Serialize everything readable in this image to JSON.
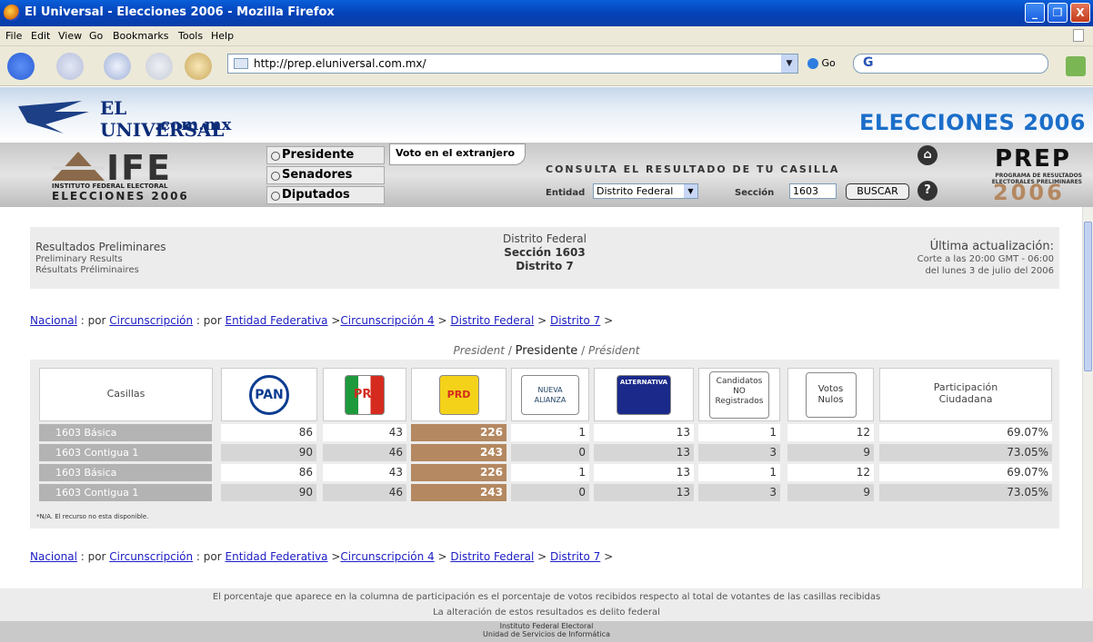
{
  "window": {
    "title": "El Universal - Elecciones 2006 - Mozilla Firefox",
    "min": "_",
    "max": "❐",
    "close": "X"
  },
  "menu": [
    "File",
    "Edit",
    "View",
    "Go",
    "Bookmarks",
    "Tools",
    "Help"
  ],
  "toolbar": {
    "url": "http://prep.eluniversal.com.mx/",
    "go_label": "Go",
    "search_value": "G"
  },
  "header": {
    "logo_line1": "EL UNIVERSAL",
    "logo_line2": ".com.mx",
    "elecciones": "ELECCIONES 2006"
  },
  "ife": {
    "big": "IFE",
    "small": "INSTITUTO FEDERAL ELECTORAL",
    "small2": "ELECCIONES 2006"
  },
  "nav": {
    "presidente": "Presidente",
    "senadores": "Senadores",
    "diputados": "Diputados",
    "voto": "Voto en el extranjero"
  },
  "search": {
    "consulta": "CONSULTA EL RESULTADO DE TU CASILLA",
    "entidad_label": "Entidad",
    "entidad_value": "Distrito Federal",
    "seccion_label": "Sección",
    "seccion_value": "1603",
    "buscar": "BUSCAR",
    "home_icon": "⌂",
    "help_icon": "?"
  },
  "prep": {
    "title": "PREP",
    "subtitle": "PROGRAMA DE RESULTADOS ELECTORALES PRELIMINARES",
    "year": "2006"
  },
  "results": {
    "es": "Resultados Preliminares",
    "en": "Preliminary Results",
    "fr": "Résultats Préliminaires",
    "entidad": "Distrito Federal",
    "seccion": "Sección 1603",
    "distrito": "Distrito 7",
    "ult": "Última actualización:",
    "corte": "Corte a las 20:00 GMT - 06:00",
    "fecha": "del lunes 3 de julio del 2006"
  },
  "breadcrumb": {
    "nacional": "Nacional",
    "sep1": " : por ",
    "circ": "Circunscripción",
    "sep2": " : por ",
    "entfed": "Entidad Federativa",
    "gt1": " >",
    "circ4": "Circunscripción 4",
    "gt2": " > ",
    "df": "Distrito Federal",
    "gt3": " > ",
    "d7": "Distrito 7",
    "gt4": " >"
  },
  "president": {
    "en": "President",
    "sep": " / ",
    "es": "Presidente",
    "sep2": " / ",
    "fr": "Président"
  },
  "table": {
    "casillas": "Casillas",
    "parties": [
      "PAN",
      "PRI",
      "PRD",
      "NUEVA ALIANZA",
      "ALTERNATIVA"
    ],
    "cnr": "Candidatos NO Registrados",
    "nulos": "Votos Nulos",
    "participacion": "Participación Ciudadana",
    "rows": [
      {
        "label": "1603 Básica",
        "vals": [
          "86",
          "43",
          "226",
          "1",
          "13",
          "1",
          "12"
        ],
        "pct": "69.07%"
      },
      {
        "label": "1603 Contigua 1",
        "vals": [
          "90",
          "46",
          "243",
          "0",
          "13",
          "3",
          "9"
        ],
        "pct": "73.05%"
      },
      {
        "label": "1603 Básica",
        "vals": [
          "86",
          "43",
          "226",
          "1",
          "13",
          "1",
          "12"
        ],
        "pct": "69.07%"
      },
      {
        "label": "1603 Contigua 1",
        "vals": [
          "90",
          "46",
          "243",
          "0",
          "13",
          "3",
          "9"
        ],
        "pct": "73.05%"
      }
    ],
    "note": "*N/A. El recurso no esta disponible."
  },
  "footer": {
    "line1": "El porcentaje que aparece en la columna de participación es el porcentaje de votos recibidos respecto al total de votantes de las casillas recibidas",
    "line2": "La alteración de estos resultados es delito federal",
    "line3": "Instituto Federal Electoral",
    "line4": "Unidad de Servicios de Informática"
  }
}
